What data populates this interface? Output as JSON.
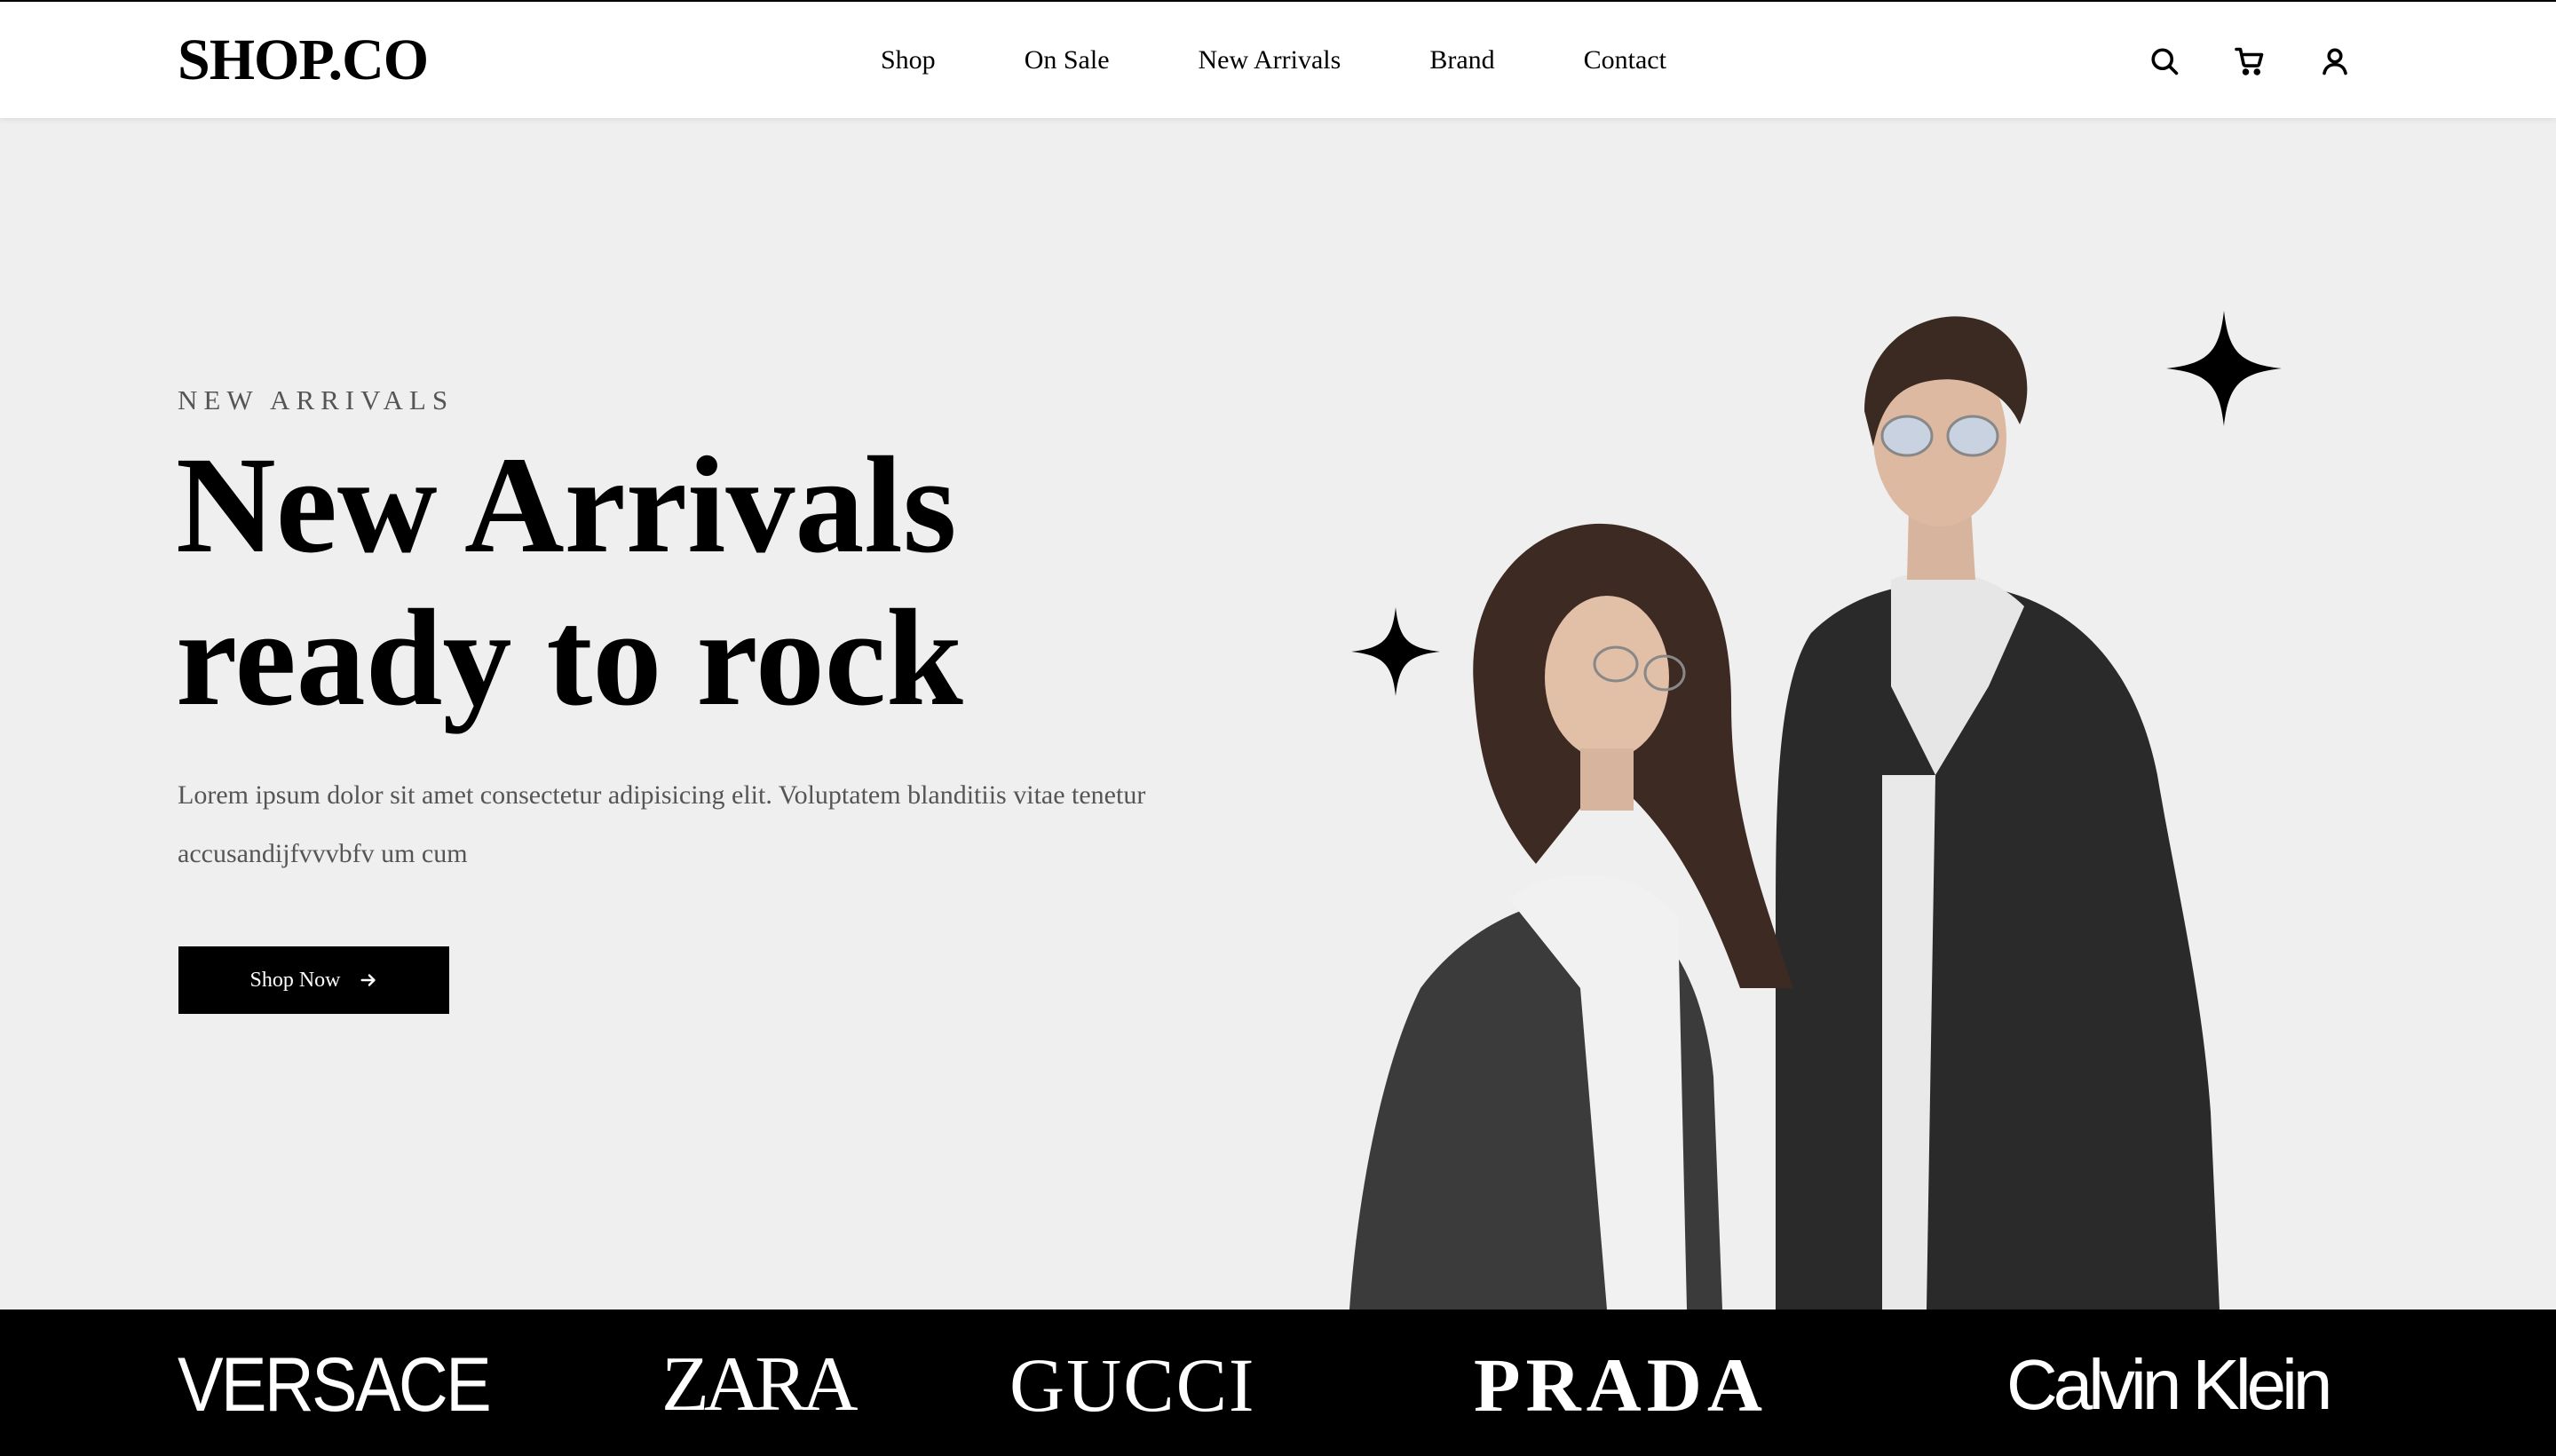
{
  "header": {
    "logo": "SHOP.CO",
    "nav": [
      {
        "label": "Shop"
      },
      {
        "label": "On Sale"
      },
      {
        "label": "New Arrivals"
      },
      {
        "label": "Brand"
      },
      {
        "label": "Contact"
      }
    ],
    "icons": [
      "search-icon",
      "cart-icon",
      "user-icon"
    ]
  },
  "hero": {
    "eyebrow": "NEW ARRIVALS",
    "headline_line1": "New Arrivals",
    "headline_line2": "ready to rock",
    "description": "Lorem ipsum dolor sit amet consectetur adipisicing elit. Voluptatem blanditiis vitae tenetur accusandijfvvvbfv um cum",
    "cta_label": "Shop Now",
    "background_color": "#efefef"
  },
  "brands": {
    "background_color": "#000000",
    "items": [
      {
        "name": "VERSACE"
      },
      {
        "name": "ZARA"
      },
      {
        "name": "GUCCI"
      },
      {
        "name": "PRADA"
      },
      {
        "name": "Calvin Klein"
      }
    ]
  }
}
